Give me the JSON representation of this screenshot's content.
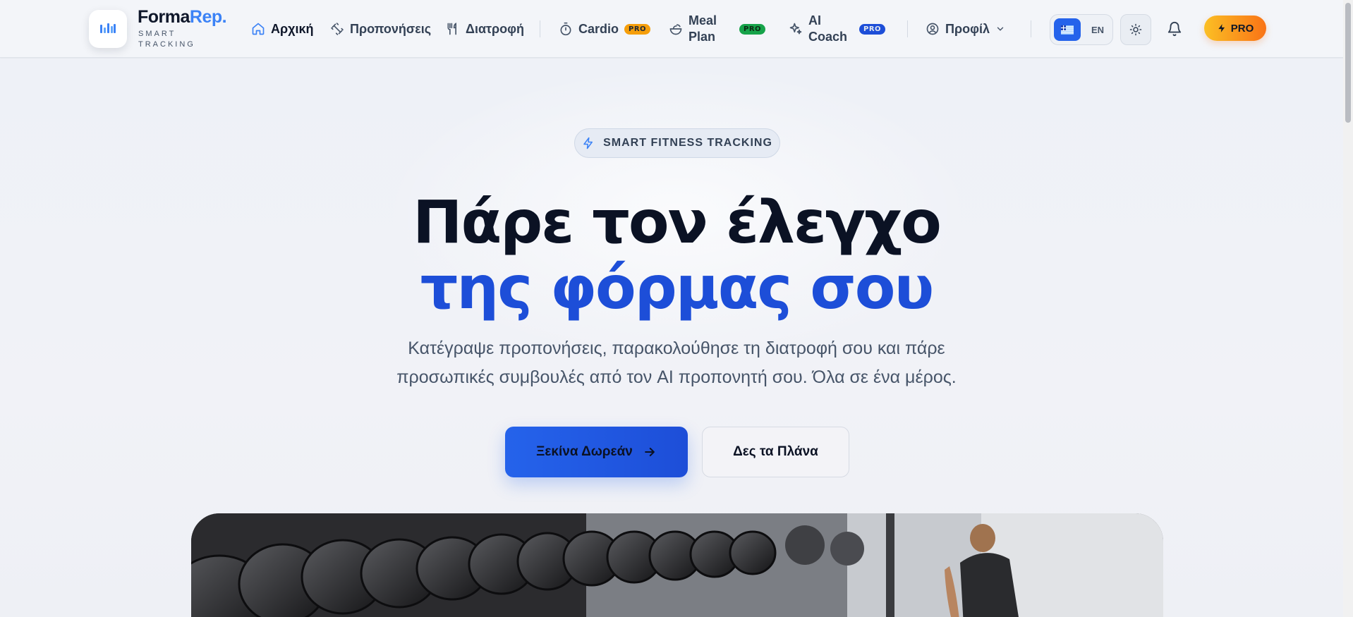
{
  "brand": {
    "name_part1": "Forma",
    "name_part2": "Rep.",
    "tagline": "SMART TRACKING",
    "accent": "#3b82f6",
    "icon": "logo-icon"
  },
  "nav": {
    "items": [
      {
        "label": "Αρχική",
        "icon": "home-icon",
        "active": true
      },
      {
        "label": "Προπονήσεις",
        "icon": "dumbbell-icon"
      },
      {
        "label": "Διατροφή",
        "icon": "utensils-icon"
      },
      {
        "label": "Cardio",
        "icon": "timer-icon",
        "badge": "PRO"
      },
      {
        "label": "Meal Plan",
        "icon": "salad-icon",
        "badge": "PRO"
      },
      {
        "label": "AI Coach",
        "icon": "sparkles-icon",
        "badge": "PRO"
      },
      {
        "label": "Προφίλ",
        "icon": "user-circle-icon"
      }
    ],
    "lang_en": "EN",
    "lang_active": "GR",
    "pro_label": "PRO"
  },
  "hero": {
    "pill": "SMART FITNESS TRACKING",
    "title_line1": "Πάρε τον έλεγχο",
    "title_line2": "της φόρμας σου",
    "lead_line1": "Κατέγραψε προπονήσεις, παρακολούθησε τη διατροφή σου και πάρε",
    "lead_line2": "προσωπικές συμβουλές από τον AI προπονητή σου. Όλα σε ένα μέρος.",
    "cta_primary": "Ξεκίνα Δωρεάν",
    "cta_secondary": "Δες τα Πλάνα"
  },
  "colors": {
    "primary": "#2563eb",
    "title_dark": "#0b1224",
    "pro_gradient_start": "#fbbf24",
    "pro_gradient_end": "#f97316"
  }
}
